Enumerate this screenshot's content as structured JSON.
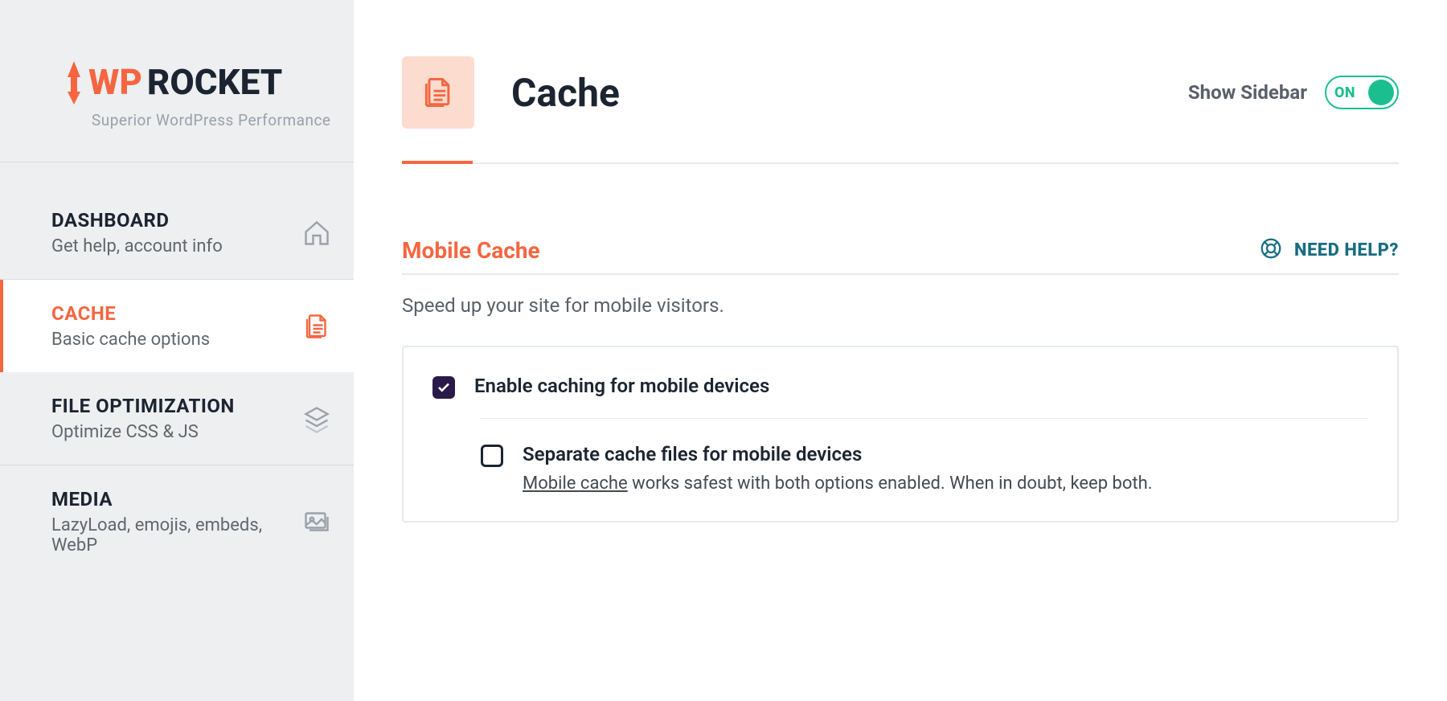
{
  "brand": {
    "wp": "WP",
    "rocket": "ROCKET",
    "tagline": "Superior WordPress Performance"
  },
  "nav": {
    "items": [
      {
        "title": "DASHBOARD",
        "sub": "Get help, account info"
      },
      {
        "title": "CACHE",
        "sub": "Basic cache options"
      },
      {
        "title": "FILE OPTIMIZATION",
        "sub": "Optimize CSS & JS"
      },
      {
        "title": "MEDIA",
        "sub": "LazyLoad, emojis, embeds, WebP"
      }
    ]
  },
  "page": {
    "title": "Cache",
    "show_sidebar_label": "Show Sidebar",
    "toggle_state": "ON"
  },
  "help": {
    "label": "NEED HELP?"
  },
  "section": {
    "title": "Mobile Cache",
    "desc": "Speed up your site for mobile visitors."
  },
  "options": {
    "opt1": {
      "label": "Enable caching for mobile devices",
      "checked": true
    },
    "opt2": {
      "label": "Separate cache files for mobile devices",
      "checked": false,
      "detail_link": "Mobile cache",
      "detail_rest": " works safest with both options enabled. When in doubt, keep both."
    }
  }
}
